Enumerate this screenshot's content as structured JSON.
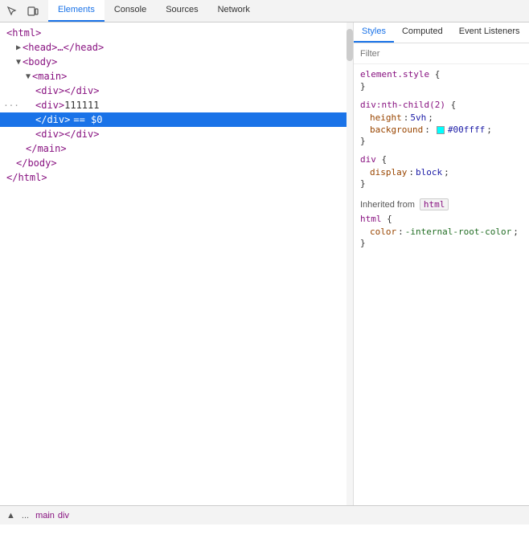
{
  "toolbar": {
    "inspect_label": "Inspect element",
    "device_label": "Toggle device toolbar"
  },
  "main_tabs": [
    {
      "label": "Elements",
      "active": true
    },
    {
      "label": "Console",
      "active": false
    },
    {
      "label": "Sources",
      "active": false
    },
    {
      "label": "Network",
      "active": false
    }
  ],
  "styles_tabs": [
    {
      "label": "Styles",
      "active": true
    },
    {
      "label": "Computed",
      "active": false
    },
    {
      "label": "Event Listeners",
      "active": false
    }
  ],
  "elements_tree": [
    {
      "indent": "indent1",
      "content": "<html>",
      "type": "normal"
    },
    {
      "indent": "indent2",
      "content": "<head>…</head>",
      "type": "normal"
    },
    {
      "indent": "indent2",
      "content": "<body>",
      "type": "normal"
    },
    {
      "indent": "indent3",
      "content": "<main>",
      "type": "normal"
    },
    {
      "indent": "indent4",
      "content": "<div></div>",
      "type": "normal"
    },
    {
      "indent": "indent4",
      "content": "<div>111111",
      "type": "normal",
      "dots": true
    },
    {
      "indent": "indent4",
      "content": "</div> == $0",
      "type": "selected"
    },
    {
      "indent": "indent4",
      "content": "<div></div>",
      "type": "normal"
    },
    {
      "indent": "indent3",
      "content": "</main>",
      "type": "normal"
    },
    {
      "indent": "indent2",
      "content": "</body>",
      "type": "normal"
    },
    {
      "indent": "indent1",
      "content": "</html>",
      "type": "normal"
    }
  ],
  "filter": {
    "placeholder": "Filter"
  },
  "css_rules": [
    {
      "selector": "element.style",
      "brace_open": "{",
      "brace_close": "}",
      "properties": []
    },
    {
      "selector": "div:nth-child(2)",
      "brace_open": "{",
      "brace_close": "}",
      "properties": [
        {
          "name": "height",
          "colon": ":",
          "value": "5vh",
          "semi": ";"
        },
        {
          "name": "background",
          "colon": ":",
          "color_swatch": "#00ffff",
          "value": "#00ffff",
          "semi": ";"
        }
      ]
    },
    {
      "selector": "div",
      "brace_open": "{",
      "brace_close": "}",
      "properties": [
        {
          "name": "display",
          "colon": ":",
          "value": "block",
          "semi": ";"
        }
      ]
    }
  ],
  "inherited": {
    "label": "Inherited from",
    "tag": "html",
    "rules": [
      {
        "selector": "html",
        "brace_open": "{",
        "brace_close": "}",
        "properties": [
          {
            "name": "color",
            "colon": ":",
            "value": "-internal-root-color",
            "semi": ";"
          }
        ]
      }
    ]
  },
  "status_bar": {
    "dots": "...",
    "breadcrumb": [
      {
        "text": "main",
        "class": "tag-color"
      },
      {
        "text": "div",
        "class": "tag-color"
      }
    ]
  }
}
